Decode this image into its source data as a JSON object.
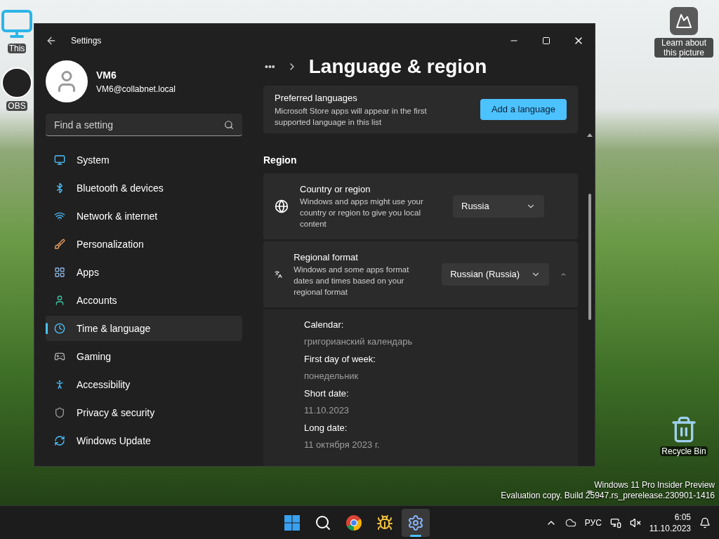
{
  "desktop": {
    "icons": [
      {
        "kind": "pc",
        "label": "This"
      },
      {
        "kind": "obs",
        "label": "OBS"
      },
      {
        "kind": "picture",
        "label": "Learn about this picture"
      },
      {
        "kind": "recycle",
        "label": "Recycle Bin"
      }
    ],
    "edition": [
      "Windows 11 Pro Insider Preview",
      "Evaluation copy. Build 25947.rs_prerelease.230901-1416"
    ]
  },
  "window": {
    "title": "Settings",
    "user": {
      "name": "VM6",
      "email": "VM6@collabnet.local"
    },
    "search": {
      "placeholder": "Find a setting"
    },
    "nav": [
      {
        "label": "System",
        "selected": false
      },
      {
        "label": "Bluetooth & devices",
        "selected": false
      },
      {
        "label": "Network & internet",
        "selected": false
      },
      {
        "label": "Personalization",
        "selected": false
      },
      {
        "label": "Apps",
        "selected": false
      },
      {
        "label": "Accounts",
        "selected": false
      },
      {
        "label": "Time & language",
        "selected": true
      },
      {
        "label": "Gaming",
        "selected": false
      },
      {
        "label": "Accessibility",
        "selected": false
      },
      {
        "label": "Privacy & security",
        "selected": false
      },
      {
        "label": "Windows Update",
        "selected": false
      }
    ]
  },
  "page": {
    "breadcrumb_more": "•••",
    "title": "Language & region",
    "preferred": {
      "title": "Preferred languages",
      "description": "Microsoft Store apps will appear in the first supported language in this list",
      "button": "Add a language"
    },
    "section": "Region",
    "settings": [
      {
        "kind": "globe",
        "title": "Country or region",
        "description": "Windows and apps might use your country or region to give you local content",
        "value": "Russia"
      },
      {
        "kind": "format",
        "title": "Regional format",
        "description": "Windows and some apps format dates and times based on your regional format",
        "value": "Russian (Russia)",
        "expanded": true
      }
    ],
    "details": [
      {
        "label": "Calendar:",
        "value": "григорианский календарь"
      },
      {
        "label": "First day of week:",
        "value": "понедельник"
      },
      {
        "label": "Short date:",
        "value": "11.10.2023"
      },
      {
        "label": "Long date:",
        "value": "11 октября 2023 г."
      }
    ]
  },
  "taskbar": {
    "apps": [
      {
        "kind": "start",
        "selected": false
      },
      {
        "kind": "search",
        "selected": false
      },
      {
        "kind": "browser",
        "selected": false
      },
      {
        "kind": "bee",
        "selected": false
      },
      {
        "kind": "settings",
        "selected": true
      }
    ],
    "language": "РУС",
    "time": "6:05",
    "date": "11.10.2023"
  }
}
